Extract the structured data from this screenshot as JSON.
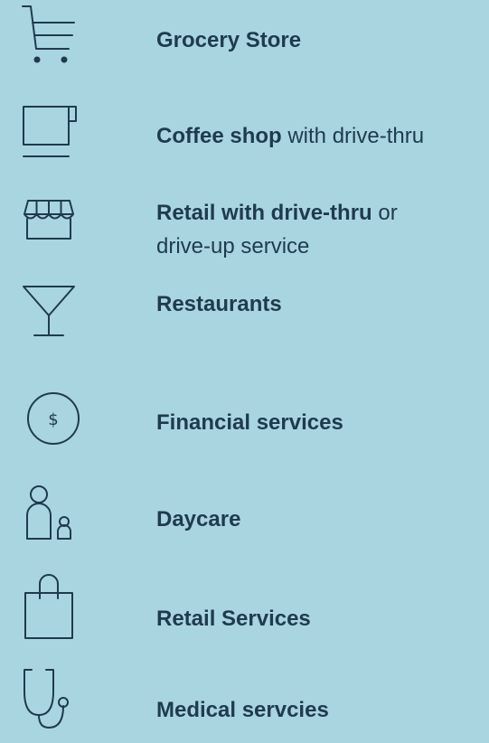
{
  "items": [
    {
      "icon": "shopping-cart-icon",
      "title": "Grocery Store",
      "suffix": ""
    },
    {
      "icon": "coffee-mug-icon",
      "title": "Coffee shop",
      "suffix": " with drive-thru"
    },
    {
      "icon": "storefront-awning-icon",
      "title": "Retail with drive-thru",
      "suffix": " or drive-up service"
    },
    {
      "icon": "martini-glass-icon",
      "title": "Restaurants",
      "suffix": ""
    },
    {
      "icon": "dollar-coin-icon",
      "title": "Financial services",
      "suffix": "",
      "glyph": "$"
    },
    {
      "icon": "adult-child-icon",
      "title": "Daycare",
      "suffix": ""
    },
    {
      "icon": "shopping-bag-icon",
      "title": "Retail Services",
      "suffix": ""
    },
    {
      "icon": "stethoscope-icon",
      "title": "Medical servcies",
      "suffix": ""
    }
  ],
  "colors": {
    "background": "#a9d5e0",
    "text": "#1f3b4d"
  }
}
